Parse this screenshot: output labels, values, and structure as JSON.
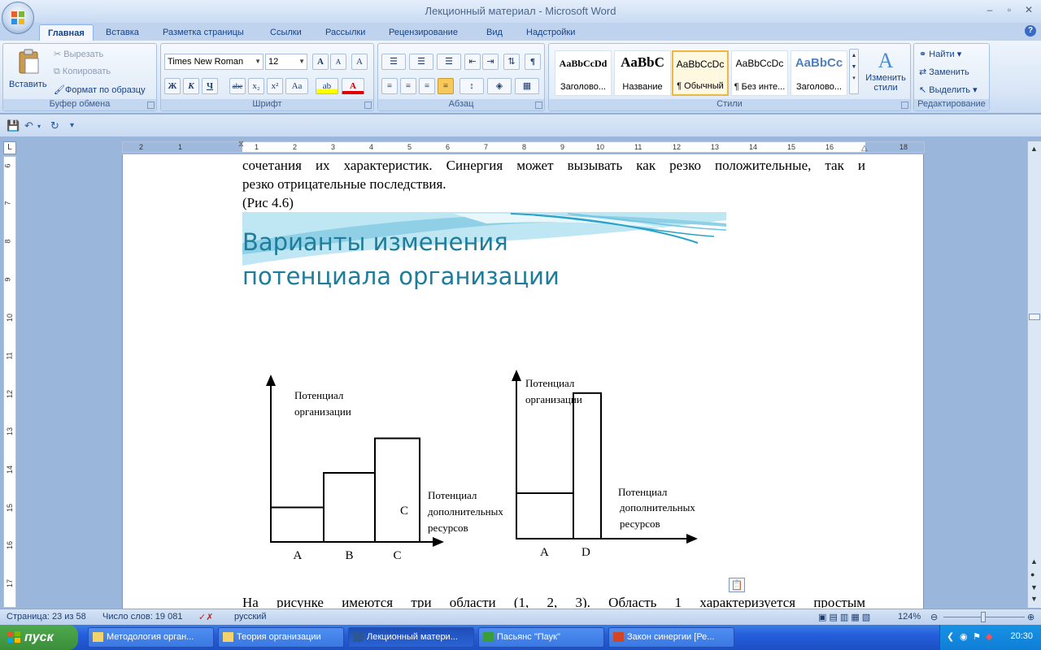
{
  "window": {
    "title": "Лекционный материал - Microsoft Word"
  },
  "tabs": [
    "Главная",
    "Вставка",
    "Разметка страницы",
    "Ссылки",
    "Рассылки",
    "Рецензирование",
    "Вид",
    "Надстройки"
  ],
  "clipboard": {
    "paste": "Вставить",
    "cut": "Вырезать",
    "copy": "Копировать",
    "format_painter": "Формат по образцу",
    "label": "Буфер обмена"
  },
  "font": {
    "name": "Times New Roman",
    "size": "12",
    "bold": "Ж",
    "italic": "К",
    "underline": "Ч",
    "strike": "abe",
    "sub": "x₂",
    "sup": "x²",
    "case": "Aa",
    "grow": "A",
    "shrink": "A",
    "label": "Шрифт"
  },
  "paragraph": {
    "label": "Абзац"
  },
  "styles": {
    "items": [
      {
        "sample": "AaBbCcDd",
        "name": "Заголово..."
      },
      {
        "sample": "AaBbC",
        "name": "Название"
      },
      {
        "sample": "AaBbCcDc",
        "name": "¶ Обычный"
      },
      {
        "sample": "AaBbCcDc",
        "name": "¶ Без инте..."
      },
      {
        "sample": "AaBbCc",
        "name": "Заголово..."
      }
    ],
    "change": "Изменить стили",
    "label": "Стили"
  },
  "editing": {
    "find": "Найти",
    "replace": "Заменить",
    "select": "Выделить",
    "label": "Редактирование"
  },
  "ruler": {
    "h_ticks": [
      "2",
      "1",
      "1",
      "2",
      "3",
      "4",
      "5",
      "6",
      "7",
      "8",
      "9",
      "10",
      "11",
      "12",
      "13",
      "14",
      "15",
      "16",
      "18"
    ],
    "v_ticks": [
      "6",
      "7",
      "8",
      "9",
      "10",
      "11",
      "12",
      "13",
      "14",
      "15",
      "16",
      "17"
    ]
  },
  "document": {
    "line1": "сочетания их характеристик. Синергия может вызывать как резко положительные, так и",
    "line2": "резко отрицательные последствия.",
    "line3": "(Рис  4.6)",
    "bottom_line": "На  рисунке  имеются  три  области  (1,  2,  3).  Область  1  характеризуется  простым"
  },
  "slide": {
    "title": "Варианты изменения\nпотенциала организации",
    "left_chart": {
      "ylabel_1": "Потенциал",
      "ylabel_2": "организации",
      "xlabel_1": "Потенциал",
      "xlabel_2": "дополнительных",
      "xlabel_3": "ресурсов",
      "inner_label": "C",
      "categories": [
        "A",
        "B",
        "C"
      ],
      "values": [
        1,
        2,
        3
      ]
    },
    "right_chart": {
      "ylabel_1": "Потенциал",
      "ylabel_2": "организации",
      "xlabel_1": "Потенциал",
      "xlabel_2": "дополнительных",
      "xlabel_3": "ресурсов",
      "categories": [
        "A",
        "D"
      ],
      "values": [
        1,
        3.2
      ]
    }
  },
  "status": {
    "page": "Страница: 23 из 58",
    "words": "Число слов: 19 081",
    "lang": "русский",
    "zoom": "124%"
  },
  "taskbar": {
    "start": "пуск",
    "tasks": [
      "Методология орган...",
      "Теория организации",
      "Лекционный матери...",
      "Пасьянс \"Паук\"",
      "Закон синергии [Ре..."
    ],
    "clock": "20:30"
  }
}
